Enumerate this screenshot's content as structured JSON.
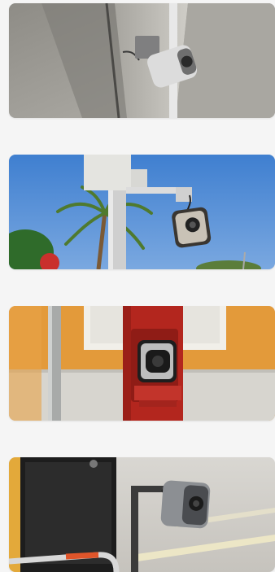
{
  "gallery": {
    "images": [
      {
        "subject": "camera-mounted-on-concrete-beam"
      },
      {
        "subject": "camera-on-street-pole-with-palm-tree"
      },
      {
        "subject": "camera-in-red-bollard"
      },
      {
        "subject": "camera-on-metal-post-near-road"
      }
    ]
  },
  "colors": {
    "page_background": "#f5f5f5",
    "sky": "#3f7fd0",
    "bollard_red": "#b3261e",
    "wall_orange": "#e39a3a",
    "concrete": "#9c9a94"
  }
}
